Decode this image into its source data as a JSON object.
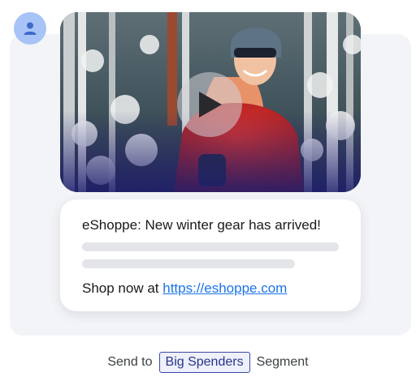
{
  "sender": {
    "avatar_icon": "person-icon",
    "avatar_color": "#a8c3f7",
    "icon_color": "#4169c9"
  },
  "media": {
    "type": "video-thumbnail",
    "play_icon": "play-icon"
  },
  "message": {
    "title": "eShoppe: New winter gear has arrived!",
    "cta_prefix": "Shop now at ",
    "cta_link": "https://eshoppe.com",
    "link_color": "#1a73e8"
  },
  "footer": {
    "send_to": "Send to",
    "segment_name": "Big Spenders",
    "suffix": "Segment",
    "chip_border_color": "#3b4aa8"
  }
}
